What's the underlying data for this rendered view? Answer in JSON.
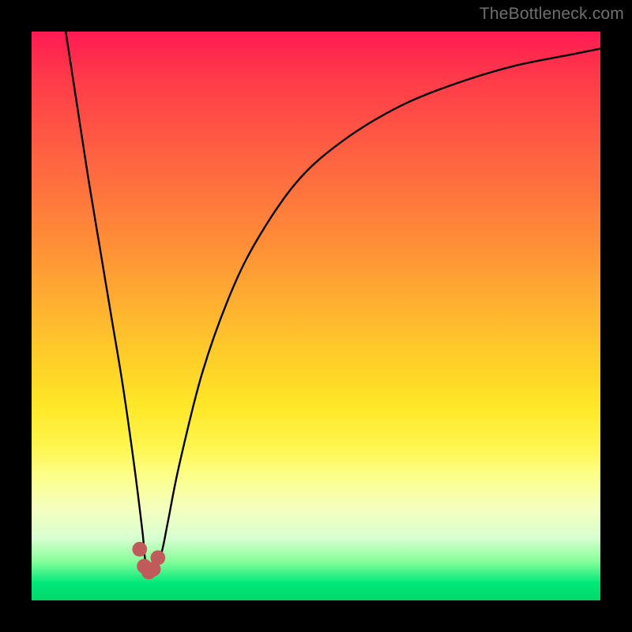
{
  "watermark": "TheBottleneck.com",
  "chart_data": {
    "type": "line",
    "title": "",
    "xlabel": "",
    "ylabel": "",
    "xlim": [
      0,
      100
    ],
    "ylim": [
      0,
      100
    ],
    "series": [
      {
        "name": "curve",
        "x": [
          6,
          8,
          10,
          12,
          14,
          16,
          18,
          19.5,
          20,
          21,
          22,
          23,
          24,
          26,
          30,
          35,
          40,
          47,
          55,
          65,
          75,
          85,
          95,
          100
        ],
        "values": [
          100,
          87,
          74,
          62,
          50,
          38,
          24,
          12,
          7,
          5,
          6,
          9,
          14,
          24,
          40,
          54,
          64,
          74,
          81,
          87,
          91,
          94,
          96,
          97
        ]
      }
    ],
    "markers": {
      "color": "#c15a5a",
      "radius_plot_units": 1.3,
      "points": [
        {
          "x": 19.0,
          "y": 9
        },
        {
          "x": 19.8,
          "y": 6
        },
        {
          "x": 20.6,
          "y": 5
        },
        {
          "x": 21.4,
          "y": 5.5
        },
        {
          "x": 22.2,
          "y": 7.5
        }
      ]
    }
  }
}
